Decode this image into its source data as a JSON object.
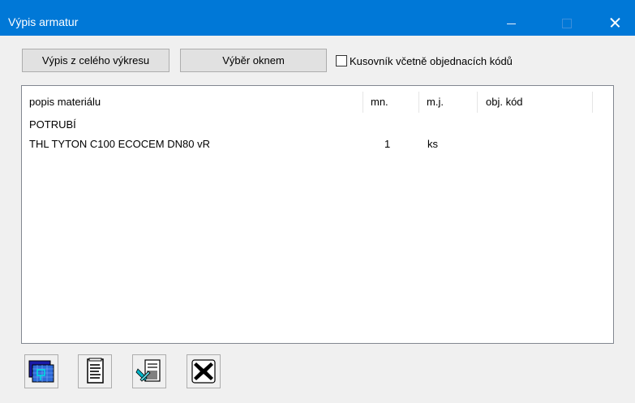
{
  "window": {
    "title": "Výpis armatur"
  },
  "buttons": {
    "full_drawing": "Výpis z celého výkresu",
    "window_select": "Výběr oknem"
  },
  "checkbox": {
    "label": "Kusovník včetně objednacích kódů",
    "checked": false
  },
  "table": {
    "columns": [
      "popis materiálu",
      "mn.",
      "m.j.",
      "obj. kód"
    ],
    "rows": [
      {
        "popis": "POTRUBÍ",
        "mn": "",
        "mj": "",
        "kod": ""
      },
      {
        "popis": "THL TYTON C100 ECOCEM DN80 vR",
        "mn": "1",
        "mj": "ks",
        "kod": ""
      }
    ]
  },
  "toolbar": {
    "icons": [
      "drawing-place-icon",
      "document-list-icon",
      "export-tools-icon",
      "close-x-icon"
    ]
  }
}
